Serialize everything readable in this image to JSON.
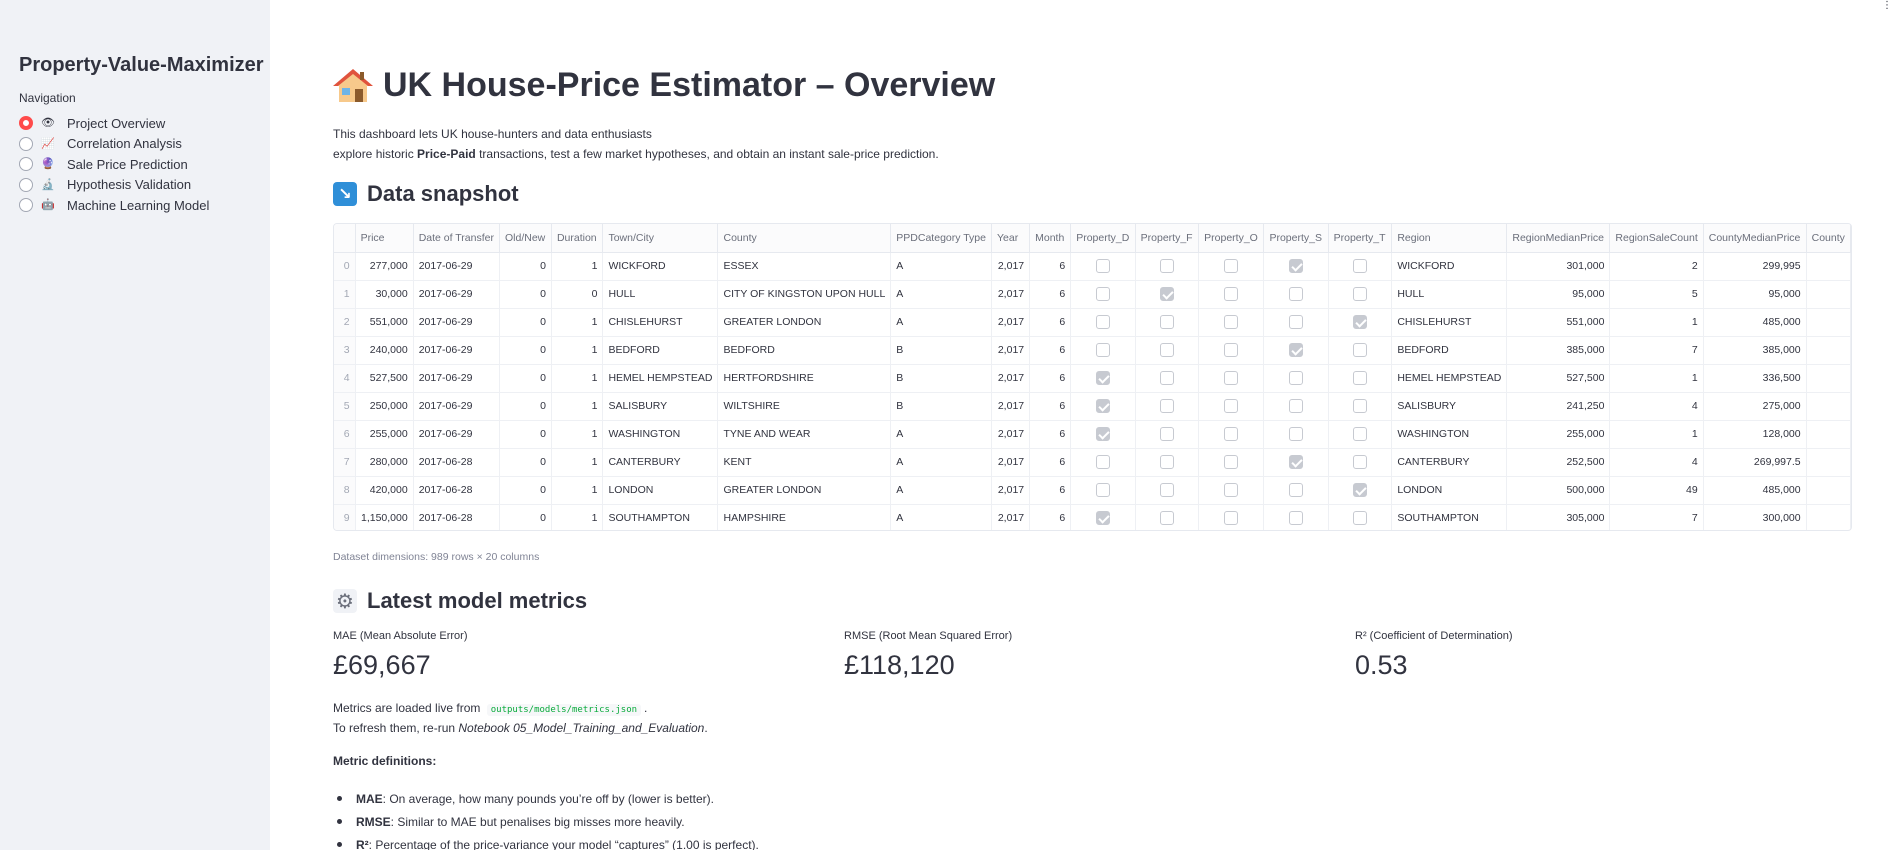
{
  "sidebar": {
    "app_title": "Property-Value-Maximizer",
    "nav_label": "Navigation",
    "items": [
      {
        "label": "Project Overview",
        "icon": "👁",
        "selected": true
      },
      {
        "label": "Correlation Analysis",
        "icon": "📈",
        "selected": false
      },
      {
        "label": "Sale Price Prediction",
        "icon": "🔮",
        "selected": false
      },
      {
        "label": "Hypothesis Validation",
        "icon": "🔬",
        "selected": false
      },
      {
        "label": "Machine Learning Model",
        "icon": "🤖",
        "selected": false
      }
    ]
  },
  "header": {
    "title": "UK House-Price Estimator – Overview",
    "intro_line1": "This dashboard lets UK house-hunters and data enthusiasts",
    "intro_line2_pre": "explore historic ",
    "intro_line2_bold": "Price-Paid",
    "intro_line2_post": " transactions, test a few market hypotheses, and obtain an instant sale-price prediction."
  },
  "snapshot": {
    "heading": "Data snapshot",
    "columns": [
      "",
      "Price",
      "Date of Transfer",
      "Old/New",
      "Duration",
      "Town/City",
      "County",
      "PPDCategory Type",
      "Year",
      "Month",
      "Property_D",
      "Property_F",
      "Property_O",
      "Property_S",
      "Property_T",
      "Region",
      "RegionMedianPrice",
      "RegionSaleCount",
      "CountyMedianPrice",
      "County"
    ],
    "rows": [
      [
        "0",
        "277,000",
        "2017-06-29",
        "0",
        "1",
        "WICKFORD",
        "ESSEX",
        "A",
        "2,017",
        "6",
        false,
        false,
        false,
        true,
        false,
        "WICKFORD",
        "301,000",
        "2",
        "299,995"
      ],
      [
        "1",
        "30,000",
        "2017-06-29",
        "0",
        "0",
        "HULL",
        "CITY OF KINGSTON UPON HULL",
        "A",
        "2,017",
        "6",
        false,
        true,
        false,
        false,
        false,
        "HULL",
        "95,000",
        "5",
        "95,000"
      ],
      [
        "2",
        "551,000",
        "2017-06-29",
        "0",
        "1",
        "CHISLEHURST",
        "GREATER LONDON",
        "A",
        "2,017",
        "6",
        false,
        false,
        false,
        false,
        true,
        "CHISLEHURST",
        "551,000",
        "1",
        "485,000"
      ],
      [
        "3",
        "240,000",
        "2017-06-29",
        "0",
        "1",
        "BEDFORD",
        "BEDFORD",
        "B",
        "2,017",
        "6",
        false,
        false,
        false,
        true,
        false,
        "BEDFORD",
        "385,000",
        "7",
        "385,000"
      ],
      [
        "4",
        "527,500",
        "2017-06-29",
        "0",
        "1",
        "HEMEL HEMPSTEAD",
        "HERTFORDSHIRE",
        "B",
        "2,017",
        "6",
        true,
        false,
        false,
        false,
        false,
        "HEMEL HEMPSTEAD",
        "527,500",
        "1",
        "336,500"
      ],
      [
        "5",
        "250,000",
        "2017-06-29",
        "0",
        "1",
        "SALISBURY",
        "WILTSHIRE",
        "B",
        "2,017",
        "6",
        true,
        false,
        false,
        false,
        false,
        "SALISBURY",
        "241,250",
        "4",
        "275,000"
      ],
      [
        "6",
        "255,000",
        "2017-06-29",
        "0",
        "1",
        "WASHINGTON",
        "TYNE AND WEAR",
        "A",
        "2,017",
        "6",
        true,
        false,
        false,
        false,
        false,
        "WASHINGTON",
        "255,000",
        "1",
        "128,000"
      ],
      [
        "7",
        "280,000",
        "2017-06-28",
        "0",
        "1",
        "CANTERBURY",
        "KENT",
        "A",
        "2,017",
        "6",
        false,
        false,
        false,
        true,
        false,
        "CANTERBURY",
        "252,500",
        "4",
        "269,997.5"
      ],
      [
        "8",
        "420,000",
        "2017-06-28",
        "0",
        "1",
        "LONDON",
        "GREATER LONDON",
        "A",
        "2,017",
        "6",
        false,
        false,
        false,
        false,
        true,
        "LONDON",
        "500,000",
        "49",
        "485,000"
      ],
      [
        "9",
        "1,150,000",
        "2017-06-28",
        "0",
        "1",
        "SOUTHAMPTON",
        "HAMPSHIRE",
        "A",
        "2,017",
        "6",
        true,
        false,
        false,
        false,
        false,
        "SOUTHAMPTON",
        "305,000",
        "7",
        "300,000"
      ]
    ],
    "dimensions": "Dataset dimensions: 989 rows × 20 columns"
  },
  "metrics": {
    "heading": "Latest model metrics",
    "items": [
      {
        "label": "MAE (Mean Absolute Error)",
        "value": "£69,667"
      },
      {
        "label": "RMSE (Root Mean Squared Error)",
        "value": "£118,120"
      },
      {
        "label": "R² (Coefficient of Determination)",
        "value": "0.53"
      }
    ],
    "loaded_pre": "Metrics are loaded live from",
    "loaded_code": "outputs/models/metrics.json",
    "loaded_post": ".",
    "refresh_pre": "To refresh them, re-run ",
    "refresh_italic": "Notebook 05_Model_Training_and_Evaluation",
    "refresh_post": ".",
    "definitions_title": "Metric definitions:",
    "definitions": [
      {
        "term": "MAE",
        "text": ": On average, how many pounds you’re off by (lower is better)."
      },
      {
        "term": "RMSE",
        "text": ": Similar to MAE but penalises big misses more heavily."
      },
      {
        "term": "R²",
        "text": ": Percentage of the price-variance your model “captures” (1.00 is perfect)."
      }
    ]
  },
  "colors": {
    "accent": "#ff4b4b",
    "sidebar_bg": "#f0f2f6",
    "text": "#31333f",
    "code": "#09ab3b"
  }
}
